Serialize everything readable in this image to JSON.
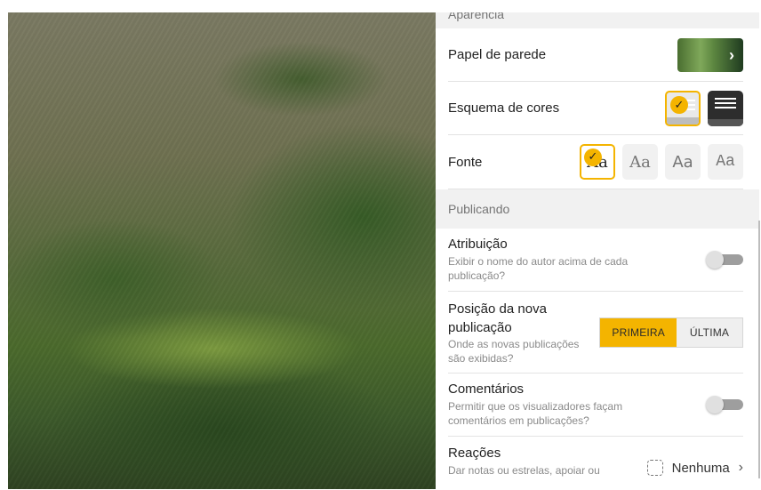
{
  "appearance": {
    "section_title": "Aparência",
    "wallpaper_label": "Papel de parede",
    "wallpaper_action_icon": "chevron-right-icon",
    "color_scheme_label": "Esquema de cores",
    "color_schemes": [
      {
        "name": "light",
        "selected": true
      },
      {
        "name": "dark",
        "selected": false
      }
    ],
    "font_label": "Fonte",
    "font_options": [
      "Aa",
      "Aa",
      "Aa",
      "Aa"
    ],
    "selected_font_index": 0
  },
  "publishing": {
    "section_title": "Publicando",
    "attribution": {
      "label": "Atribuição",
      "description": "Exibir o nome do autor acima de cada publicação?",
      "enabled": false
    },
    "new_post_position": {
      "label": "Posição da nova publicação",
      "description": "Onde as novas publicações são exibidas?",
      "options": [
        "PRIMEIRA",
        "ÚLTIMA"
      ],
      "selected": "PRIMEIRA"
    },
    "comments": {
      "label": "Comentários",
      "description": "Permitir que os visualizadores façam comentários em publicações?",
      "enabled": false
    },
    "reactions": {
      "label": "Reações",
      "description": "Dar notas ou estrelas, apoiar ou",
      "value": "Nenhuma"
    }
  },
  "colors": {
    "accent": "#f4b400",
    "panel_bg": "#ffffff",
    "section_bg": "#f1f1f1"
  }
}
